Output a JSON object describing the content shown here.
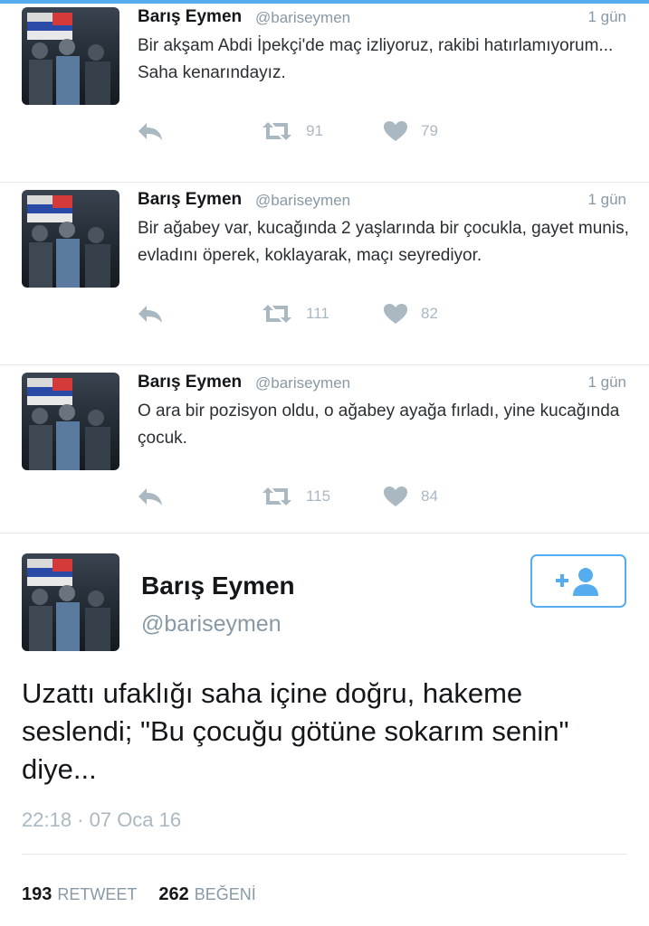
{
  "tweets": [
    {
      "name": "Barış Eymen",
      "handle": "@bariseymen",
      "time": "1 gün",
      "text": "Bir akşam Abdi İpekçi'de maç izliyoruz, rakibi hatırlamıyorum... Saha kenarındayız.",
      "retweets": "91",
      "likes": "79"
    },
    {
      "name": "Barış Eymen",
      "handle": "@bariseymen",
      "time": "1 gün",
      "text": "Bir ağabey var, kucağında 2 yaşlarında bir çocukla, gayet munis, evladını öperek, koklayarak, maçı seyrediyor.",
      "retweets": "111",
      "likes": "82"
    },
    {
      "name": "Barış Eymen",
      "handle": "@bariseymen",
      "time": "1 gün",
      "text": "O ara bir pozisyon oldu, o ağabey ayağa fırladı, yine kucağında çocuk.",
      "retweets": "115",
      "likes": "84"
    }
  ],
  "main_tweet": {
    "name": "Barış Eymen",
    "handle": "@bariseymen",
    "text": "Uzattı ufaklığı saha içine doğru, hakeme seslendi; \"Bu çocuğu götüne sokarım senin\" diye...",
    "timestamp": "22:18 · 07 Oca 16",
    "retweet_count": "193",
    "retweet_label": "RETWEET",
    "like_count": "262",
    "like_label": "BEĞENİ"
  },
  "colors": {
    "accent": "#55acee",
    "muted": "#aab8c2",
    "secondary_text": "#8899a6"
  },
  "icons": {
    "reply": "reply-icon",
    "retweet": "retweet-icon",
    "like": "heart-icon",
    "follow": "follow-user-icon"
  }
}
